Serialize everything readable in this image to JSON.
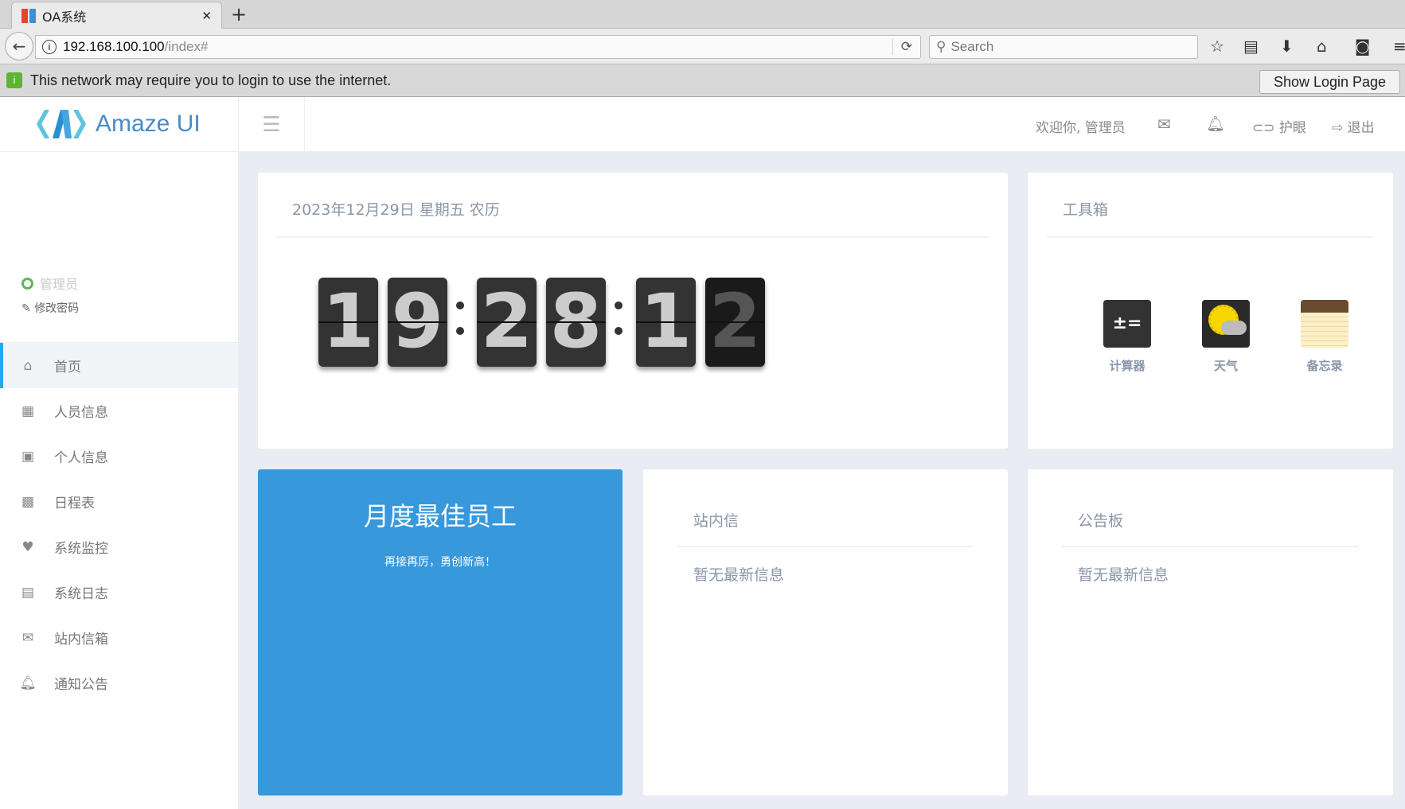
{
  "browser": {
    "tab_title": "OA系统",
    "url_host": "192.168.100.100",
    "url_path": "/index#",
    "search_placeholder": "Search",
    "notification": "This network may require you to login to use the internet.",
    "login_button": "Show Login Page"
  },
  "header": {
    "logo": "Amaze UI",
    "welcome": "欢迎你, 管理员",
    "eye_care": "护眼",
    "logout": "退出"
  },
  "sidebar": {
    "user": "管理员",
    "change_password": "修改密码",
    "items": [
      {
        "label": "首页",
        "icon": "home-icon"
      },
      {
        "label": "人员信息",
        "icon": "table-icon"
      },
      {
        "label": "个人信息",
        "icon": "id-card-icon"
      },
      {
        "label": "日程表",
        "icon": "calendar-icon"
      },
      {
        "label": "系统监控",
        "icon": "heartbeat-icon"
      },
      {
        "label": "系统日志",
        "icon": "list-icon"
      },
      {
        "label": "站内信箱",
        "icon": "envelope-icon"
      },
      {
        "label": "通知公告",
        "icon": "bell-icon"
      }
    ]
  },
  "clock": {
    "date": "2023年12月29日 星期五 农历",
    "digits": [
      "1",
      "9",
      "2",
      "8",
      "1",
      "2"
    ]
  },
  "toolbox": {
    "title": "工具箱",
    "tools": [
      "计算器",
      "天气",
      "备忘录"
    ]
  },
  "employee": {
    "title": "月度最佳员工",
    "slogan": "再接再厉，勇创新高！"
  },
  "mail": {
    "title": "站内信",
    "empty": "暂无最新信息"
  },
  "notice": {
    "title": "公告板",
    "empty": "暂无最新信息"
  },
  "colors": {
    "accent": "#3798dc",
    "sidebar_active": "#28a6f0"
  }
}
